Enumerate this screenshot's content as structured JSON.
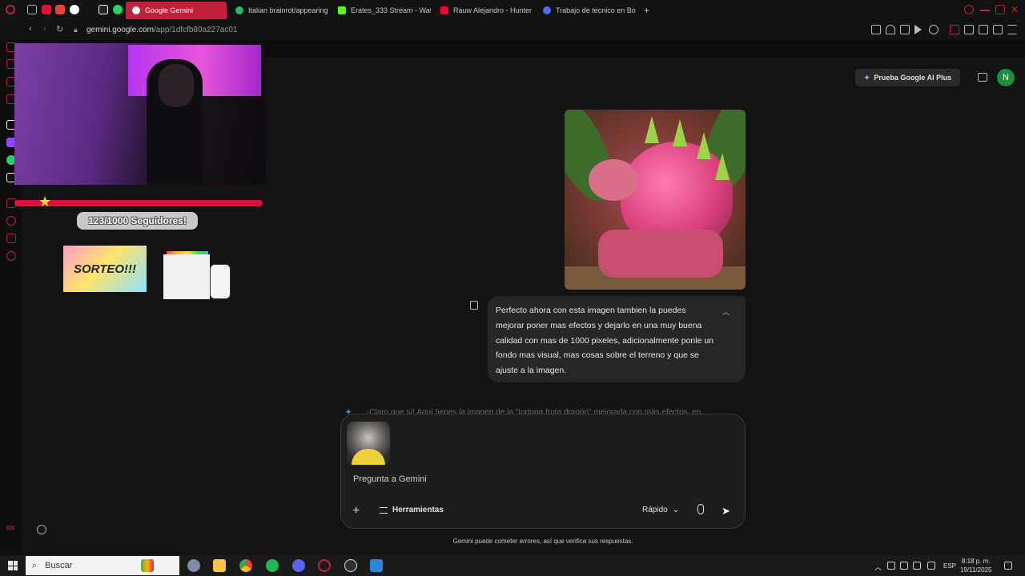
{
  "browser": {
    "tabs": [
      {
        "label": "Google Gemini",
        "active": true,
        "color": "#c1203a"
      },
      {
        "label": "Italian brainrot/appearing",
        "active": false,
        "color": "#2fb567"
      },
      {
        "label": "Erates_333 Stream - Wat",
        "active": false,
        "color": "#53fc18"
      },
      {
        "label": "Rauw Alejandro - Hunter",
        "active": false,
        "color": "#ff0033"
      },
      {
        "label": "Trabajo de tecnico en Bog",
        "active": false,
        "color": "#4e6ef2"
      }
    ],
    "new_tab": "+",
    "url_domain": "gemini.google.com",
    "url_path": "/app/1dfcfb80a227ac01"
  },
  "overlay": {
    "followers": "123/1000 Seguidores!",
    "progress_fraction": 0.12,
    "sorteo": "SORTEO!!!"
  },
  "header": {
    "plus_button": "Prueba Google AI Plus",
    "avatar_letter": "N"
  },
  "chat": {
    "user_message": "Perfecto ahora con esta imagen tambien la puedes mejorar poner mas efectos y dejarlo en una muy buena calidad con mas de 1000 pixeles, adicionalmente ponle un fondo mas visual, mas cosas sobre el terreno y que se ajuste a la imagen.",
    "response_peek": "¡Claro que sí! Aquí tienes la imagen de la \"tortuga fruta dragón\" mejorada con más efectos, en"
  },
  "composer": {
    "placeholder": "Pregunta a Gemini",
    "tools_label": "Herramientas",
    "mode_label": "Rápido"
  },
  "disclaimer": "Gemini puede cometer errores, así que verifica sus respuestas.",
  "sidebar": {
    "gx_label": "GX"
  },
  "taskbar": {
    "search_placeholder": "Buscar",
    "language": "ESP",
    "time": "8:18 p. m.",
    "date": "19/11/2025"
  }
}
